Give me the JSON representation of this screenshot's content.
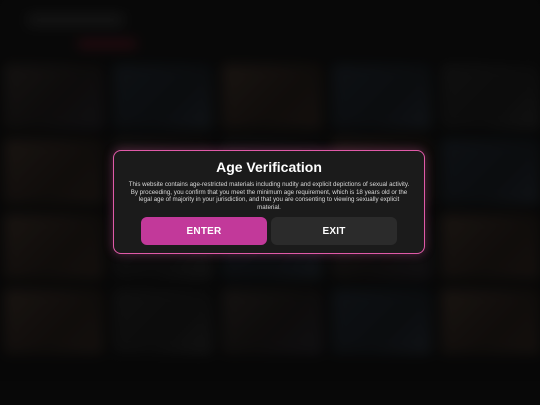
{
  "age_gate": {
    "title": "Age Verification",
    "message": "This website contains age-restricted materials including nudity and explicit depictions of sexual activity. By proceeding, you confirm that you meet the minimum age requirement, which is 18 years old or the legal age of majority in your jurisdiction, and that you are consenting to viewing sexually explicit material.",
    "enter_label": "ENTER",
    "exit_label": "EXIT"
  },
  "colors": {
    "accent_border": "#e05aa8",
    "enter_button": "#c2399a",
    "exit_button": "#2b2b2b",
    "modal_background": "#1b1b1b",
    "page_background": "#0e0e0e"
  }
}
